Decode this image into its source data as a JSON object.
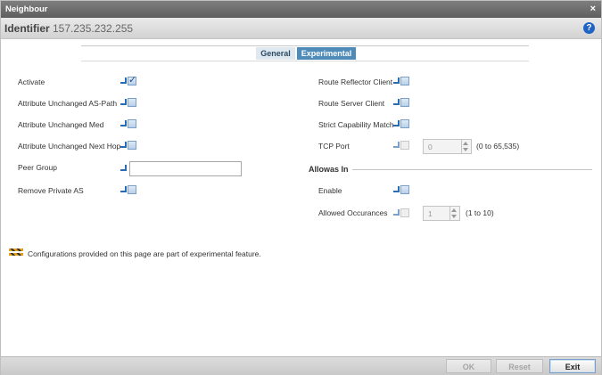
{
  "window": {
    "title": "Neighbour",
    "close_glyph": "×"
  },
  "identifier": {
    "label": "Identifier",
    "value": "157.235.232.255",
    "help_glyph": "?"
  },
  "tabs": {
    "general": "General",
    "experimental": "Experimental",
    "active": "Experimental"
  },
  "left_fields": {
    "activate": {
      "label": "Activate",
      "checked": true
    },
    "attr_unchanged_as_path": {
      "label": "Attribute Unchanged AS-Path",
      "checked": false
    },
    "attr_unchanged_med": {
      "label": "Attribute Unchanged Med",
      "checked": false
    },
    "attr_unchanged_next_hop": {
      "label": "Attribute Unchanged Next Hop",
      "checked": false
    },
    "peer_group": {
      "label": "Peer Group",
      "value": ""
    },
    "remove_private_as": {
      "label": "Remove Private AS",
      "checked": false
    }
  },
  "right_fields": {
    "route_reflector_client": {
      "label": "Route Reflector Client",
      "checked": false
    },
    "route_server_client": {
      "label": "Route Server Client",
      "checked": false
    },
    "strict_capability_match": {
      "label": "Strict Capability Match",
      "checked": false
    },
    "tcp_port": {
      "label": "TCP Port",
      "value": "0",
      "range": "(0 to 65,535)"
    }
  },
  "allowas_in": {
    "title": "Allowas In",
    "enable": {
      "label": "Enable",
      "checked": false
    },
    "allowed_occurances": {
      "label": "Allowed Occurances",
      "value": "1",
      "range": "(1 to 10)"
    }
  },
  "note": {
    "icon": "construction-barrier-icon",
    "text": "Configurations provided on this page are part of experimental feature."
  },
  "footer": {
    "ok": "OK",
    "reset": "Reset",
    "exit": "Exit"
  },
  "colors": {
    "accent": "#4f8bb8",
    "titlebar": "#6e6e6e",
    "help": "#1f64c4"
  }
}
